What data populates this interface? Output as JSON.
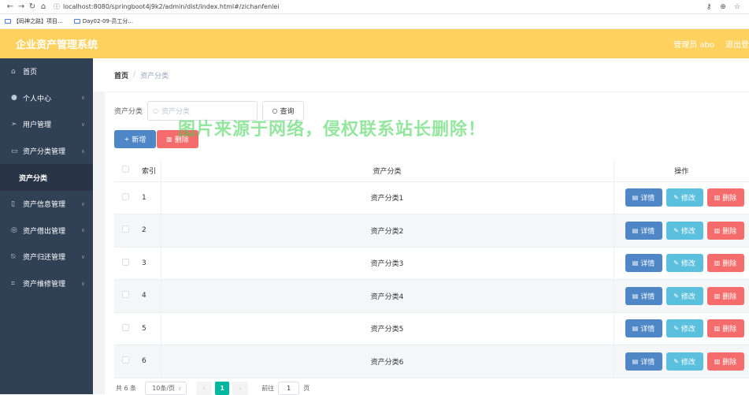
{
  "browser": {
    "url": "localhost:8080/springboot4j9k2/admin/dist/index.html#/zichanfenlei",
    "bookmarks": [
      "【码神之路】项目...",
      "Day02-09-员工分..."
    ]
  },
  "header": {
    "title": "企业资产管理系统",
    "user": "管理员 abo",
    "logout": "退出登"
  },
  "sidebar": {
    "items": [
      {
        "label": "首页",
        "icon": "home-icon"
      },
      {
        "label": "个人中心",
        "icon": "user-icon"
      },
      {
        "label": "用户管理",
        "icon": "send-icon"
      },
      {
        "label": "资产分类管理",
        "icon": "chart-icon"
      },
      {
        "label": "资产分类",
        "icon": ""
      },
      {
        "label": "资产信息管理",
        "icon": "device-icon"
      },
      {
        "label": "资产借出管理",
        "icon": "globe-icon"
      },
      {
        "label": "资产归还管理",
        "icon": "bell-off-icon"
      },
      {
        "label": "资产维修管理",
        "icon": "crop-icon"
      }
    ]
  },
  "breadcrumb": {
    "home": "首页",
    "sep": "/",
    "current": "资产分类"
  },
  "search": {
    "label": "资产分类",
    "placeholder": "资产分类",
    "button": "查询"
  },
  "actions": {
    "add": "新增",
    "delete": "删除"
  },
  "watermark": "图片来源于网络，侵权联系站长删除！",
  "table": {
    "headers": {
      "index": "索引",
      "name": "资产分类",
      "ops": "操作"
    },
    "rows": [
      {
        "index": "1",
        "name": "资产分类1"
      },
      {
        "index": "2",
        "name": "资产分类2"
      },
      {
        "index": "3",
        "name": "资产分类3"
      },
      {
        "index": "4",
        "name": "资产分类4"
      },
      {
        "index": "5",
        "name": "资产分类5"
      },
      {
        "index": "6",
        "name": "资产分类6"
      }
    ],
    "row_buttons": {
      "detail": "详情",
      "edit": "修改",
      "remove": "删除"
    }
  },
  "pagination": {
    "total": "共 6 条",
    "page_size": "10条/页",
    "current_page": "1",
    "goto_label": "前往",
    "goto_value": "1",
    "page_suffix": "页"
  },
  "colors": {
    "header": "#ffd25f",
    "sidebar": "#304156",
    "primary": "#4f86c6",
    "danger": "#f56c6c",
    "info": "#5bc0de",
    "active_page": "#00b8a0"
  }
}
